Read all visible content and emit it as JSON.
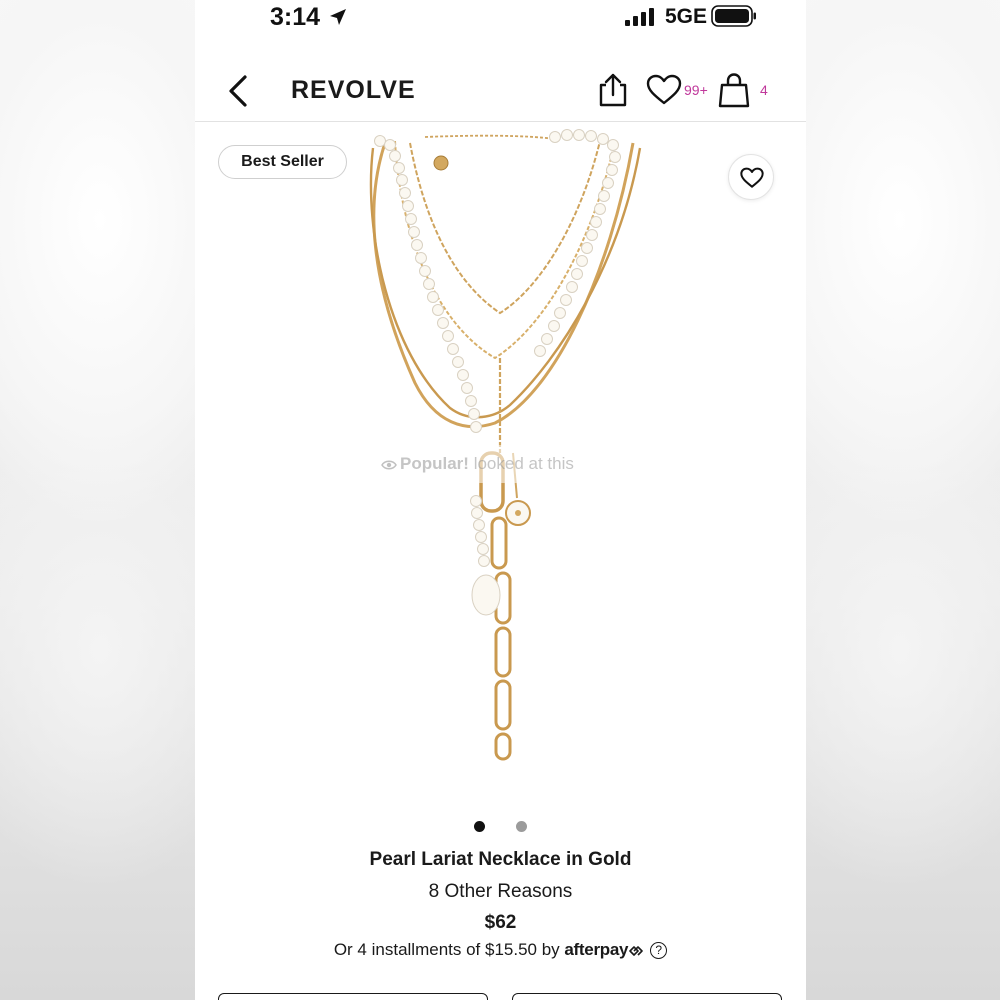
{
  "status_bar": {
    "time": "3:14",
    "network": "5GE"
  },
  "nav": {
    "brand": "REVOLVE",
    "wishlist_count": "99+",
    "bag_count": "4"
  },
  "product": {
    "badge": "Best Seller",
    "popular_label": "Popular!",
    "popular_rest": "looked at this",
    "image_count": 2,
    "active_image": 1,
    "name": "Pearl Lariat Necklace in Gold",
    "brand": "8 Other Reasons",
    "price": "$62",
    "installments_text": "Or 4 installments of $15.50 by",
    "afterpay_label": "afterpay",
    "info_label": "?"
  },
  "icons": {
    "back": "chevron-left-icon",
    "share": "share-icon",
    "wishlist": "heart-icon",
    "bag": "shopping-bag-icon",
    "favorite": "heart-icon",
    "location": "location-arrow-icon",
    "signal": "signal-icon",
    "battery": "battery-icon",
    "eye": "eye-icon"
  },
  "colors": {
    "accent": "#c0389b",
    "text": "#1a1a1a",
    "gold": "#d4a962"
  }
}
